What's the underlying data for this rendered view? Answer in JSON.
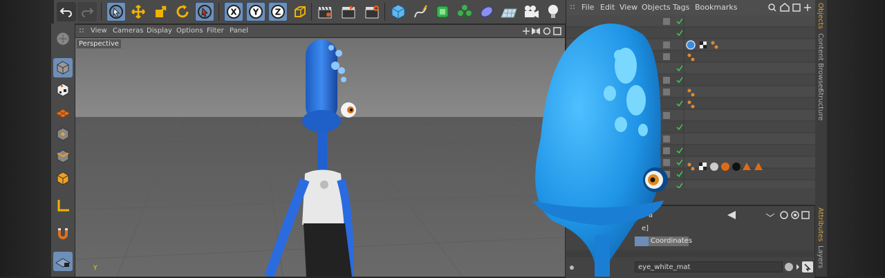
{
  "viewport": {
    "menu": [
      "View",
      "Cameras",
      "Display",
      "Options",
      "Filter",
      "Panel"
    ],
    "label": "Perspective",
    "axis_y": "Y"
  },
  "object_manager": {
    "menu": [
      "File",
      "Edit",
      "View",
      "Objects",
      "Tags",
      "Bookmarks"
    ]
  },
  "side_tabs": [
    "Objects",
    "Content Browser",
    "Structure",
    "Attributes",
    "Layers"
  ],
  "attributes": {
    "coordinates_tab": "Coordinates",
    "material_field": "eye_white_mat",
    "partial_label_1": "a",
    "partial_label_2": "e]"
  },
  "toolbar": {
    "axis_x": "X",
    "axis_y": "Y",
    "axis_z": "Z"
  },
  "colors": {
    "accent_selected": "#6d8fb8",
    "character_blue": "#2b8fe0",
    "active_tab": "#d8a040"
  }
}
